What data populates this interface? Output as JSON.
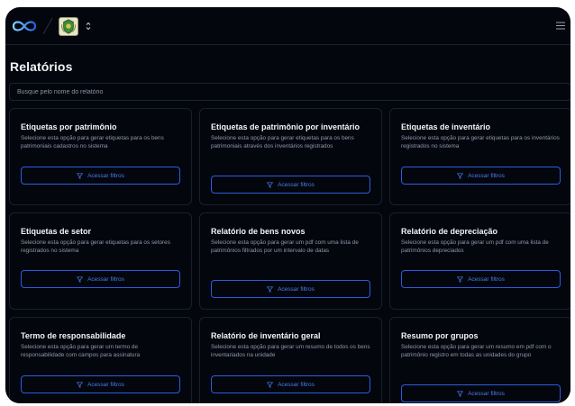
{
  "page": {
    "title": "Relatórios"
  },
  "search": {
    "placeholder": "Busque pelo nome do relatório"
  },
  "colors": {
    "accent": "#2a5de0",
    "background": "#04060d",
    "border": "#1a202c"
  },
  "icons": {
    "logo": "infinity-logo-icon",
    "crest": "institution-crest-icon",
    "selector": "chevron-up-down-icon",
    "menu": "hamburger-menu-icon",
    "filter": "filter-icon"
  },
  "cards": [
    {
      "title": "Etiquetas por patrimônio",
      "description": "Selecione esta opção para gerar etiquetas para os bens patrimoniais cadastros no sistema",
      "button": "Acessar filtros"
    },
    {
      "title": "Etiquetas de patrimônio por inventário",
      "description": "Selecione esta opção para gerar etiquetas para os bens patrimoniais através dos inventários registrados",
      "button": "Acessar filtros"
    },
    {
      "title": "Etiquetas de inventário",
      "description": "Selecione esta opção para gerar etiquetas para os inventários registrados no sistema",
      "button": "Acessar filtros"
    },
    {
      "title": "Etiquetas de setor",
      "description": "Selecione esta opção para gerar etiquetas para os setores registrados no sistema",
      "button": "Acessar filtros"
    },
    {
      "title": "Relatório de bens novos",
      "description": "Selecione esta opção para gerar um pdf com uma lista de patrimônios filtrados por um intervalo de datas",
      "button": "Acessar filtros"
    },
    {
      "title": "Relatório de depreciação",
      "description": "Selecione esta opção para gerar um pdf com uma lista de patrimônios depreciados",
      "button": "Acessar filtros"
    },
    {
      "title": "Termo de responsabilidade",
      "description": "Selecione esta opção para gerar um termo de responsabilidade com campos para assinatura",
      "button": "Acessar filtros"
    },
    {
      "title": "Relatório de inventário geral",
      "description": "Selecione esta opção para gerar um resumo de todos os bens inventariados na unidade",
      "button": "Acessar filtros"
    },
    {
      "title": "Resumo por grupos",
      "description": "Selecione esta opção para gerar um resumo em pdf com o patrimônio registro em todas as unidades do grupo",
      "button": "Acessar filtros"
    }
  ]
}
